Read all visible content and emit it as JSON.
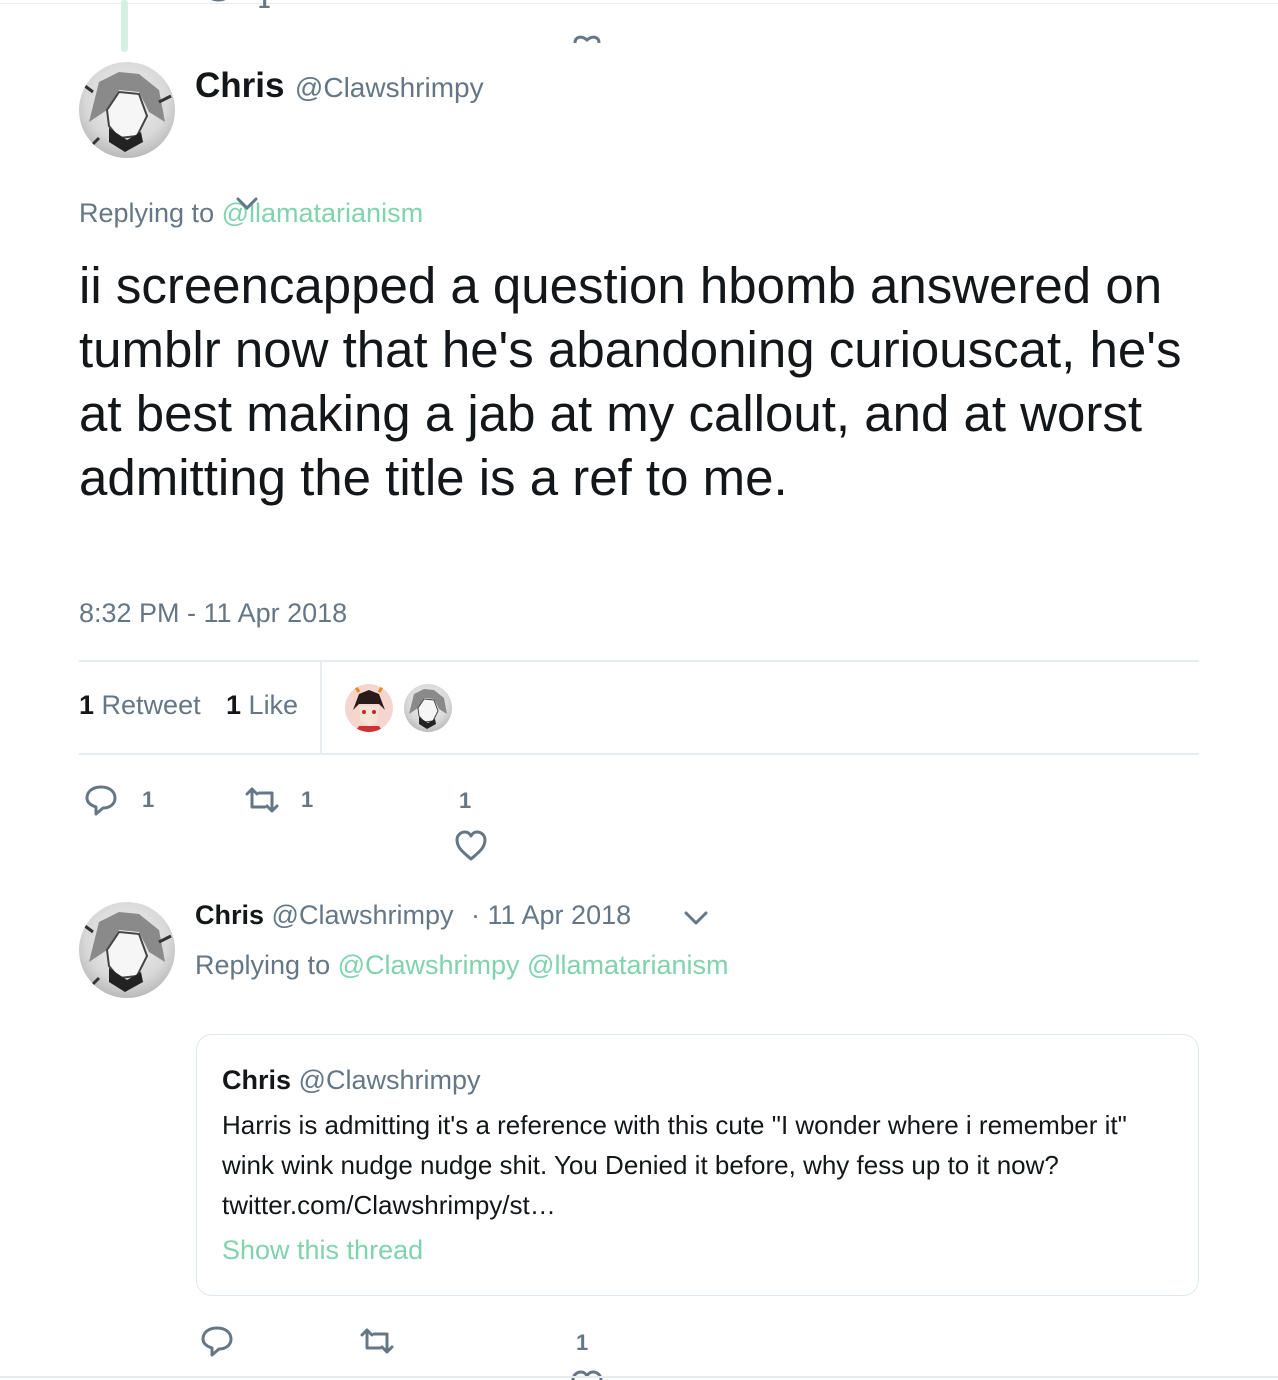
{
  "main_tweet": {
    "author_name": "Chris",
    "author_handle": "@Clawshrimpy",
    "replying_prefix": "Replying to",
    "replying_handle": "@llamatarianism",
    "text": "ii screencapped a question hbomb answered on tumblr now that he's abandoning curiouscat, he's at best making a jab at my callout, and at worst admitting the title is a ref to me.",
    "timestamp": "8:32 PM - 11 Apr 2018",
    "retweet_count": "1",
    "retweet_label": "Retweet",
    "like_count": "1",
    "like_label": "Like",
    "reply_action_count": "1",
    "retweet_action_count": "1",
    "like_action_count": "1"
  },
  "reply_tweet": {
    "author_name": "Chris",
    "author_handle": "@Clawshrimpy",
    "date": "· 11 Apr 2018",
    "replying_prefix": "Replying to",
    "replying_handles": "@Clawshrimpy @llamatarianism",
    "quote": {
      "author_name": "Chris",
      "author_handle": "@Clawshrimpy",
      "text": "Harris is admitting it's a reference with this cute \"I wonder where i remember it\" wink wink nudge nudge shit. You Denied it before, why fess up to it now? twitter.com/Clawshrimpy/st…",
      "show_thread": "Show this thread"
    },
    "like_action_count": "1"
  },
  "top_partial": {
    "reply_count": "1"
  },
  "colors": {
    "accent": "#7fd3ad",
    "muted": "#657786",
    "text": "#14171a",
    "border": "#e6ecf0"
  }
}
